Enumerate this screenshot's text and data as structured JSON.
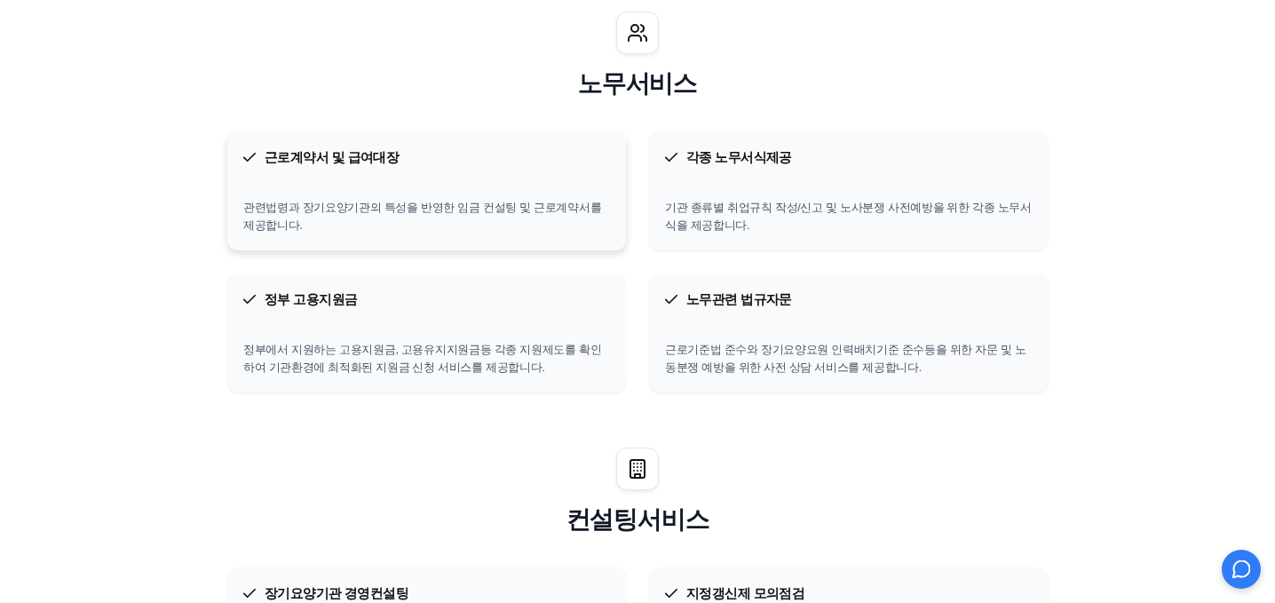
{
  "sections": [
    {
      "kind": "people",
      "title": "노무서비스",
      "cards": [
        {
          "title": "근로계약서 및 급여대장",
          "description": "관련법령과 장기요양기관의 특성을 반영한 임금 컨설팅 및 근로계약서를 제공합니다.",
          "hovered": true
        },
        {
          "title": "각종 노무서식제공",
          "description": "기관 종류별 취업규칙 작성/신고 및 노사분쟁 사전예방을 위한 각종 노무서식을 제공합니다.",
          "hovered": false
        },
        {
          "title": "정부 고용지원금",
          "description": "정부에서 지원하는 고용지원금, 고용유지지원금등 각종 지원제도를 확인하여 기관환경에 최적화된 지원금 신청 서비스를 제공합니다.",
          "hovered": false
        },
        {
          "title": "노무관련 법규자문",
          "description": "근로기준법 준수와 장기요양요원 인력배치기준 준수등을 위한 자문 및 노동분쟁 예방을 위한 사전 상담 서비스를 제공합니다.",
          "hovered": false
        }
      ]
    },
    {
      "kind": "building",
      "title": "컨설팅서비스",
      "cards": [
        {
          "title": "장기요양기관 경영컨설팅"
        },
        {
          "title": "지정갱신제 모의점검"
        }
      ]
    }
  ]
}
